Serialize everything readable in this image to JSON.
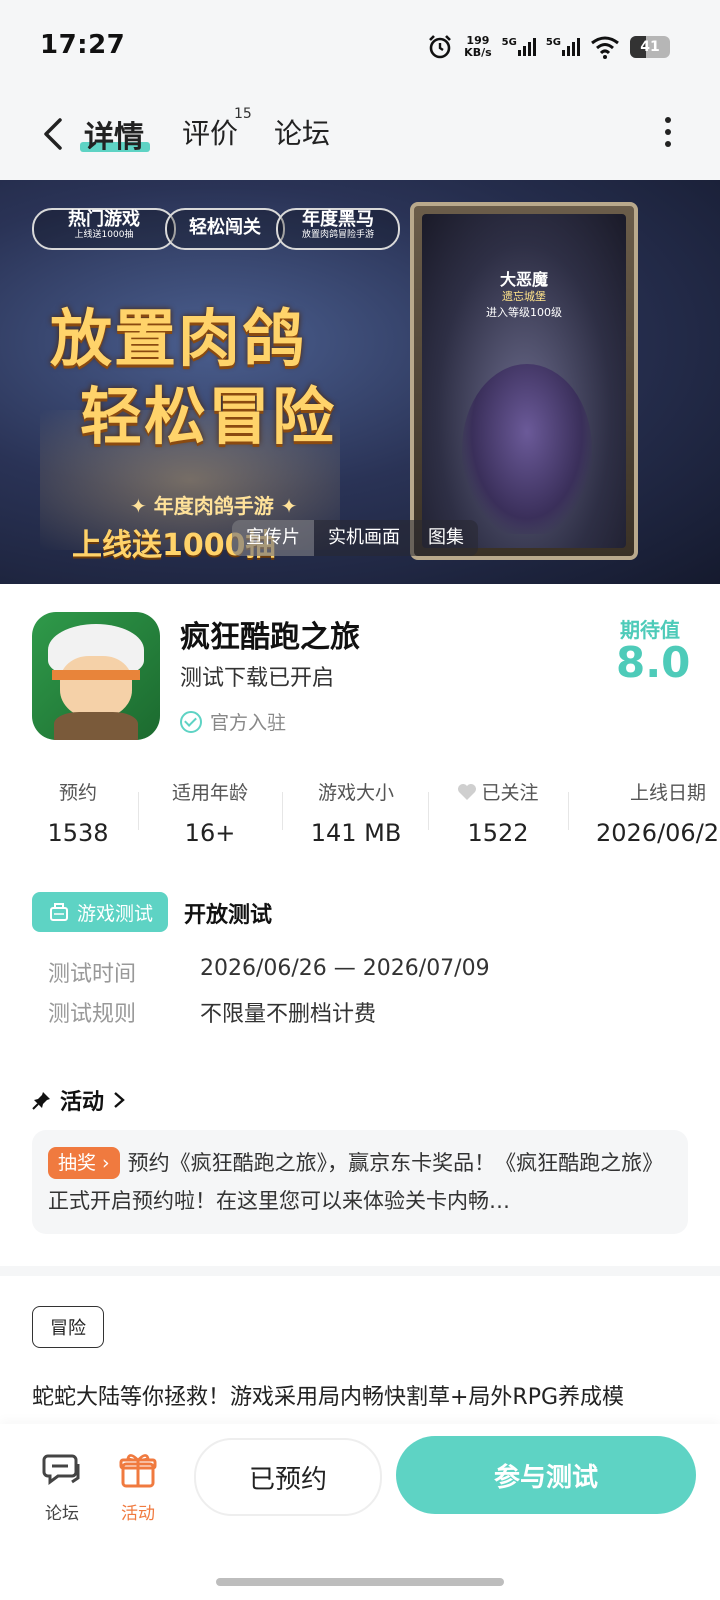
{
  "status": {
    "time": "17:27",
    "speed_value": "199",
    "speed_unit": "KB/s",
    "net1": "5G",
    "net2": "5G",
    "battery": "41"
  },
  "nav": {
    "tab_details": "详情",
    "tab_reviews": "评价",
    "reviews_count": "15",
    "tab_forum": "论坛"
  },
  "banner": {
    "badge1": "热门游戏",
    "badge1_sub": "上线送1000抽",
    "badge2": "轻松闯关",
    "badge3": "年度黑马",
    "badge3_sub": "放置肉鸽冒险手游",
    "title_line1": "放置肉鸽",
    "title_line2": "轻松冒险",
    "subtitle": "✦ 年度肉鸽手游 ✦",
    "promo": "上线送1000抽",
    "card_title": "大恶魔",
    "card_line1": "遗忘城堡",
    "card_line2": "进入等级100级",
    "media_tabs": [
      "宣传片",
      "实机画面",
      "图集"
    ]
  },
  "app": {
    "name": "疯狂酷跑之旅",
    "subtitle": "测试下载已开启",
    "official": "官方入驻",
    "expect_label": "期待值",
    "expect_value": "8.0"
  },
  "stats": [
    {
      "label": "预约",
      "value": "1538"
    },
    {
      "label": "适用年龄",
      "value": "16+"
    },
    {
      "label": "游戏大小",
      "value": "141 MB"
    },
    {
      "label": "已关注",
      "value": "1522"
    },
    {
      "label": "上线日期",
      "value": "2026/06/2"
    }
  ],
  "test": {
    "tag": "游戏测试",
    "type": "开放测试",
    "time_label": "测试时间",
    "time_value": "2026/06/26 — 2026/07/09",
    "rule_label": "测试规则",
    "rule_value": "不限量不删档计费"
  },
  "activity": {
    "heading": "活动",
    "tag": "抽奖",
    "text": "预约《疯狂酷跑之旅》，赢京东卡奖品！《疯狂酷跑之旅》正式开启预约啦！在这里您可以来体验关卡内畅…"
  },
  "genre": "冒险",
  "description": "蛇蛇大陆等你拯救！游戏采用局内畅快割草+局外RPG养成模",
  "bottom": {
    "forum": "论坛",
    "activity": "活动",
    "reserved": "已预约",
    "join": "参与测试"
  },
  "colors": {
    "accent": "#5ed3c4",
    "orange": "#f07a3f"
  }
}
